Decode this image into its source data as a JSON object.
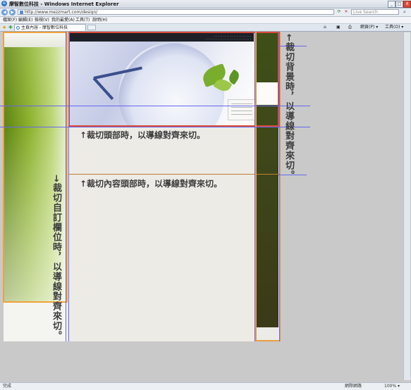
{
  "window": {
    "title": "摩智數位科技 - Windows Internet Explorer",
    "minimize": "_",
    "maximize": "□",
    "close": "X"
  },
  "address": {
    "url": "http://www.mezzmart.com/design/",
    "search_placeholder": "Live Search"
  },
  "menu": [
    "檔案(F)",
    "編輯(E)",
    "檢視(V)",
    "我的最愛(A)",
    "工具(T)",
    "說明(H)"
  ],
  "tabs": {
    "active_tab": "主頁內容 - 摩智數位科技",
    "tools": [
      "網頁(P) ▾",
      "工具(O) ▾"
    ]
  },
  "captions": {
    "header_cut": "↑裁切頭部時，以導線對齊來切。",
    "content_cut": "↑裁切內容頭部時，以導線對齊來切。",
    "column_cut": "→裁切自訂欄位時，以導線對齊來切。",
    "background_cut": "←裁切背景時，以導線對齊來切。"
  },
  "status": {
    "text": "完成",
    "zone": "網際網路",
    "zoom": "100% ▾"
  },
  "colors": {
    "guide": "#6666ee",
    "header_frame": "#d94b3a",
    "column_frame": "#f0a23c",
    "background_frame": "#e8a040"
  }
}
